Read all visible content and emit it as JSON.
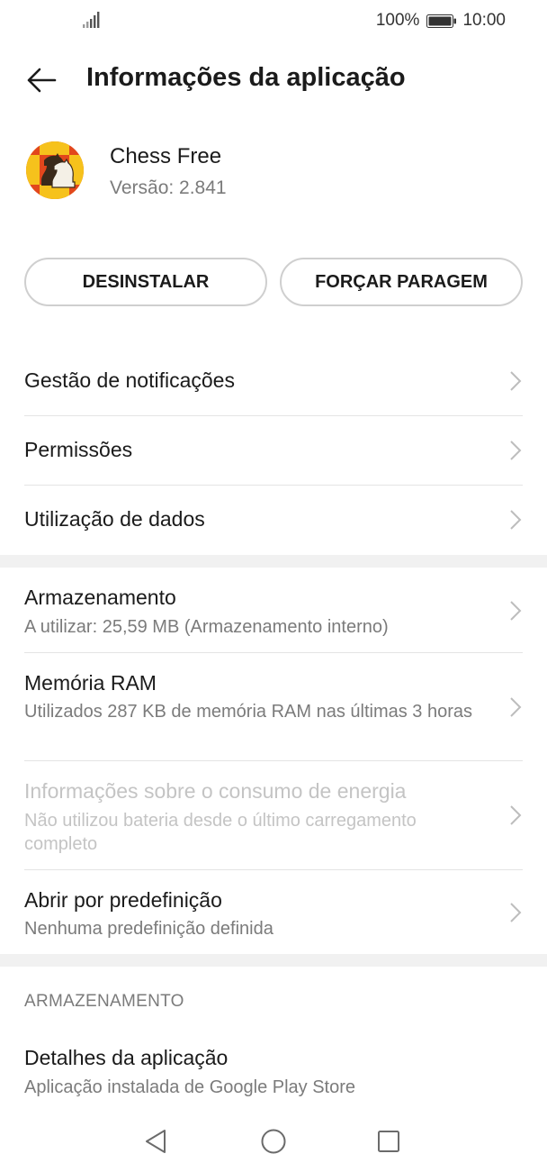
{
  "status_bar": {
    "battery_percent": "100%",
    "time": "10:00",
    "icons": [
      "signal-icon",
      "battery-icon"
    ]
  },
  "app_bar": {
    "back_icon": "back-arrow-icon",
    "title": "Informações da aplicação"
  },
  "app": {
    "name": "Chess Free",
    "version": "Versão: 2.841",
    "icon": "chess-knight-icon",
    "icon_colors": [
      "#e2471c",
      "#f6c21c"
    ]
  },
  "buttons": {
    "uninstall": "DESINSTALAR",
    "force_stop": "FORÇAR PARAGEM"
  },
  "rows": [
    {
      "title": "Gestão de notificações"
    },
    {
      "title": "Permissões"
    },
    {
      "title": "Utilização de dados"
    },
    {
      "title": "Armazenamento",
      "subtitle": "A utilizar: 25,59 MB (Armazenamento interno)"
    },
    {
      "title": "Memória RAM",
      "subtitle": "Utilizados 287 KB de memória RAM nas últimas 3 horas"
    },
    {
      "title": "Informações sobre o consumo de energia",
      "subtitle": "Não utilizou bateria desde o último carregamento completo",
      "disabled": true
    },
    {
      "title": "Abrir por predefinição",
      "subtitle": "Nenhuma predefinição definida"
    }
  ],
  "section_header": "ARMAZENAMENTO",
  "details_row": {
    "title": "Detalhes da aplicação",
    "subtitle": "Aplicação instalada de Google Play Store"
  },
  "nav_bar": {
    "icons": [
      "nav-back-icon",
      "nav-home-icon",
      "nav-recent-icon"
    ]
  },
  "colors": {
    "text_primary": "#1b1b1b",
    "text_secondary": "#7b7b7b",
    "text_disabled": "#c4c4c4",
    "divider": "#e4e4e4",
    "section_gap": "#f1f1f1"
  }
}
